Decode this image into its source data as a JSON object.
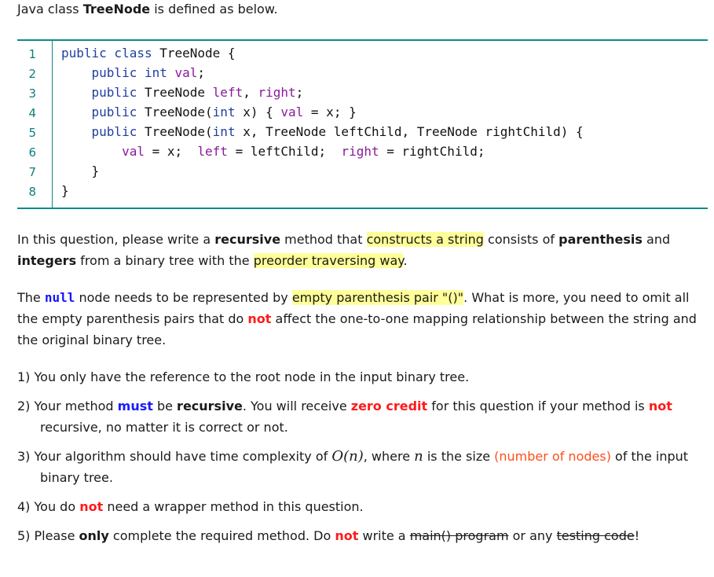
{
  "intro": {
    "prefix": "Java class ",
    "class_name": "TreeNode",
    "suffix": " is defined as below."
  },
  "code": {
    "line_numbers": [
      "1",
      "2",
      "3",
      "4",
      "5",
      "6",
      "7",
      "8"
    ],
    "lines": [
      [
        {
          "t": "public class ",
          "c": "kw"
        },
        {
          "t": "TreeNode {",
          "c": "plain"
        }
      ],
      [
        {
          "t": "    public int ",
          "c": "kw"
        },
        {
          "t": "val",
          "c": "fld"
        },
        {
          "t": ";",
          "c": "plain"
        }
      ],
      [
        {
          "t": "    public ",
          "c": "kw"
        },
        {
          "t": "TreeNode ",
          "c": "plain"
        },
        {
          "t": "left",
          "c": "fld"
        },
        {
          "t": ", ",
          "c": "plain"
        },
        {
          "t": "right",
          "c": "fld"
        },
        {
          "t": ";",
          "c": "plain"
        }
      ],
      [
        {
          "t": "    public ",
          "c": "kw"
        },
        {
          "t": "TreeNode(",
          "c": "plain"
        },
        {
          "t": "int ",
          "c": "kw"
        },
        {
          "t": "x) { ",
          "c": "plain"
        },
        {
          "t": "val",
          "c": "fld"
        },
        {
          "t": " = x; }",
          "c": "plain"
        }
      ],
      [
        {
          "t": "    public ",
          "c": "kw"
        },
        {
          "t": "TreeNode(",
          "c": "plain"
        },
        {
          "t": "int ",
          "c": "kw"
        },
        {
          "t": "x, TreeNode leftChild, TreeNode rightChild) {",
          "c": "plain"
        }
      ],
      [
        {
          "t": "        ",
          "c": "plain"
        },
        {
          "t": "val",
          "c": "fld"
        },
        {
          "t": " = x;  ",
          "c": "plain"
        },
        {
          "t": "left",
          "c": "fld"
        },
        {
          "t": " = leftChild;  ",
          "c": "plain"
        },
        {
          "t": "right",
          "c": "fld"
        },
        {
          "t": " = rightChild;",
          "c": "plain"
        }
      ],
      [
        {
          "t": "    }",
          "c": "plain"
        }
      ],
      [
        {
          "t": "}",
          "c": "plain"
        }
      ]
    ]
  },
  "para1": {
    "s1": "In this question, please write a ",
    "b1": "recursive",
    "s2": " method that ",
    "h1": "constructs a string",
    "s3": " consists of ",
    "b2": "parenthesis",
    "s4": " and ",
    "b3": "integers",
    "s5": " from a binary tree with the ",
    "h2": "preorder traversing way",
    "s6": "."
  },
  "para2": {
    "s1": "The ",
    "null_kw": "null",
    "s2": " node needs to be represented by ",
    "h1": "empty parenthesis pair \"()\"",
    "s3": ".  What is more, you need to omit all the empty parenthesis pairs that do ",
    "r1": "not",
    "s4": " affect the one-to-one mapping relationship between the string and the original binary tree."
  },
  "rules": {
    "r1": {
      "num": "1) ",
      "text": "You only have the reference to the root node in the input binary tree."
    },
    "r2": {
      "num": "2) ",
      "s1": "Your method ",
      "must": "must",
      "s2": " be ",
      "recursive": "recursive",
      "s3": ".  You will receive ",
      "zero": "zero credit",
      "s4": " for this question if your method is ",
      "not": "not",
      "s5": " recursive, no matter it is correct or not."
    },
    "r3": {
      "num": "3) ",
      "s1": "Your algorithm should have time complexity of ",
      "math1": "O(n)",
      "s2": ", where ",
      "math2": "n",
      "s3": " is the size ",
      "orange": "(number of nodes)",
      "s4": " of the input binary tree."
    },
    "r4": {
      "num": "4) ",
      "s1": "You do ",
      "not": "not",
      "s2": " need a wrapper method in this question."
    },
    "r5": {
      "num": "5) ",
      "s1": "Please ",
      "only": "only",
      "s2": " complete the required method.  Do ",
      "not": "not",
      "s3": " write a ",
      "strike1": "main() program",
      "s4": " or any ",
      "strike2": "testing code",
      "s5": "!"
    }
  }
}
